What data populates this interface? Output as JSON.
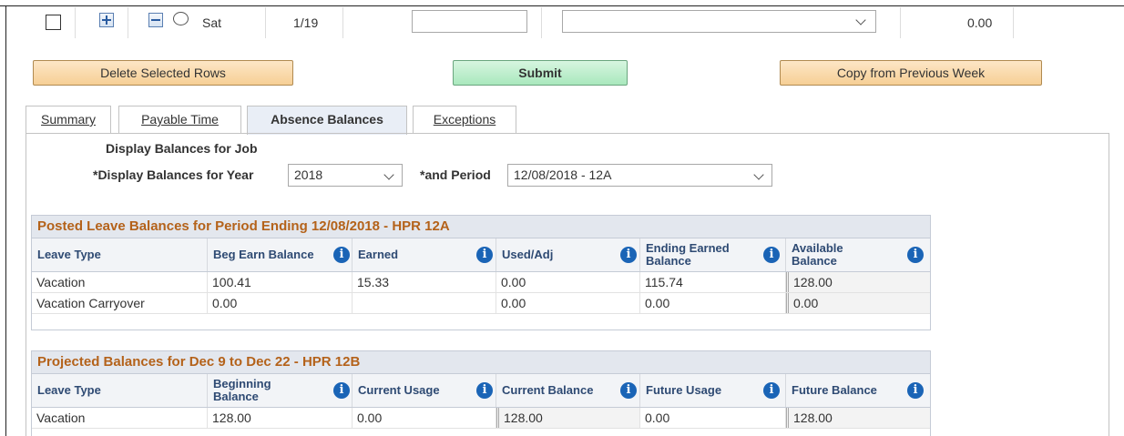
{
  "top_row": {
    "day": "Sat",
    "date": "1/19",
    "hours_value": "",
    "trc_value": "",
    "total": "0.00"
  },
  "buttons": {
    "delete_rows": "Delete Selected Rows",
    "submit": "Submit",
    "copy_prev": "Copy from Previous Week"
  },
  "tabs": [
    {
      "label": "Summary"
    },
    {
      "label": "Payable Time"
    },
    {
      "label": "Absence Balances"
    },
    {
      "label": "Exceptions"
    }
  ],
  "filters": {
    "display_for_job": "Display Balances for Job",
    "year_label": "*Display Balances for Year",
    "year_value": "2018",
    "period_label": "*and Period",
    "period_value": "12/08/2018 - 12A"
  },
  "posted": {
    "title": "Posted Leave Balances for Period Ending 12/08/2018 - HPR 12A",
    "headers": {
      "leave_type": "Leave Type",
      "beg": "Beg Earn Balance",
      "earned": "Earned",
      "used": "Used/Adj",
      "ending_1": "Ending Earned",
      "ending_2": "Balance",
      "avail_1": "Available",
      "avail_2": "Balance"
    },
    "rows": [
      {
        "type": "Vacation",
        "beg": "100.41",
        "earned": "15.33",
        "used": "0.00",
        "ending": "115.74",
        "avail": "128.00"
      },
      {
        "type": "Vacation Carryover",
        "beg": "0.00",
        "earned": "",
        "used": "0.00",
        "ending": "0.00",
        "avail": "0.00"
      }
    ]
  },
  "projected": {
    "title": "Projected Balances for Dec 9 to Dec 22 - HPR 12B",
    "headers": {
      "leave_type": "Leave Type",
      "beg_1": "Beginning",
      "beg_2": "Balance",
      "current_usage": "Current Usage",
      "current_balance": "Current Balance",
      "future_usage": "Future Usage",
      "future_balance": "Future Balance"
    },
    "rows": [
      {
        "type": "Vacation",
        "beg": "128.00",
        "cur_usage": "0.00",
        "cur_balance": "128.00",
        "fut_usage": "0.00",
        "fut_balance": "128.00"
      }
    ]
  },
  "info_icon_glyph": "i",
  "colors": {
    "grid_title": "#b4621a",
    "header_text": "#2e4a73",
    "info_icon": "#1a64b6",
    "submit_bg": "#a9e8bd",
    "action_bg": "#f6cf95"
  }
}
